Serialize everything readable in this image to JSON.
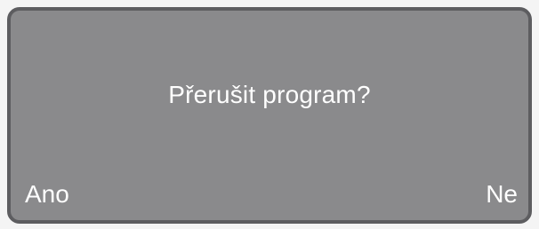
{
  "display": {
    "message": "Přerušit program?",
    "left_softkey": "Ano",
    "right_softkey": "Ne"
  },
  "colors": {
    "screen_background": "#8a8a8c",
    "screen_border": "#5d5d60",
    "text": "#ffffff"
  }
}
